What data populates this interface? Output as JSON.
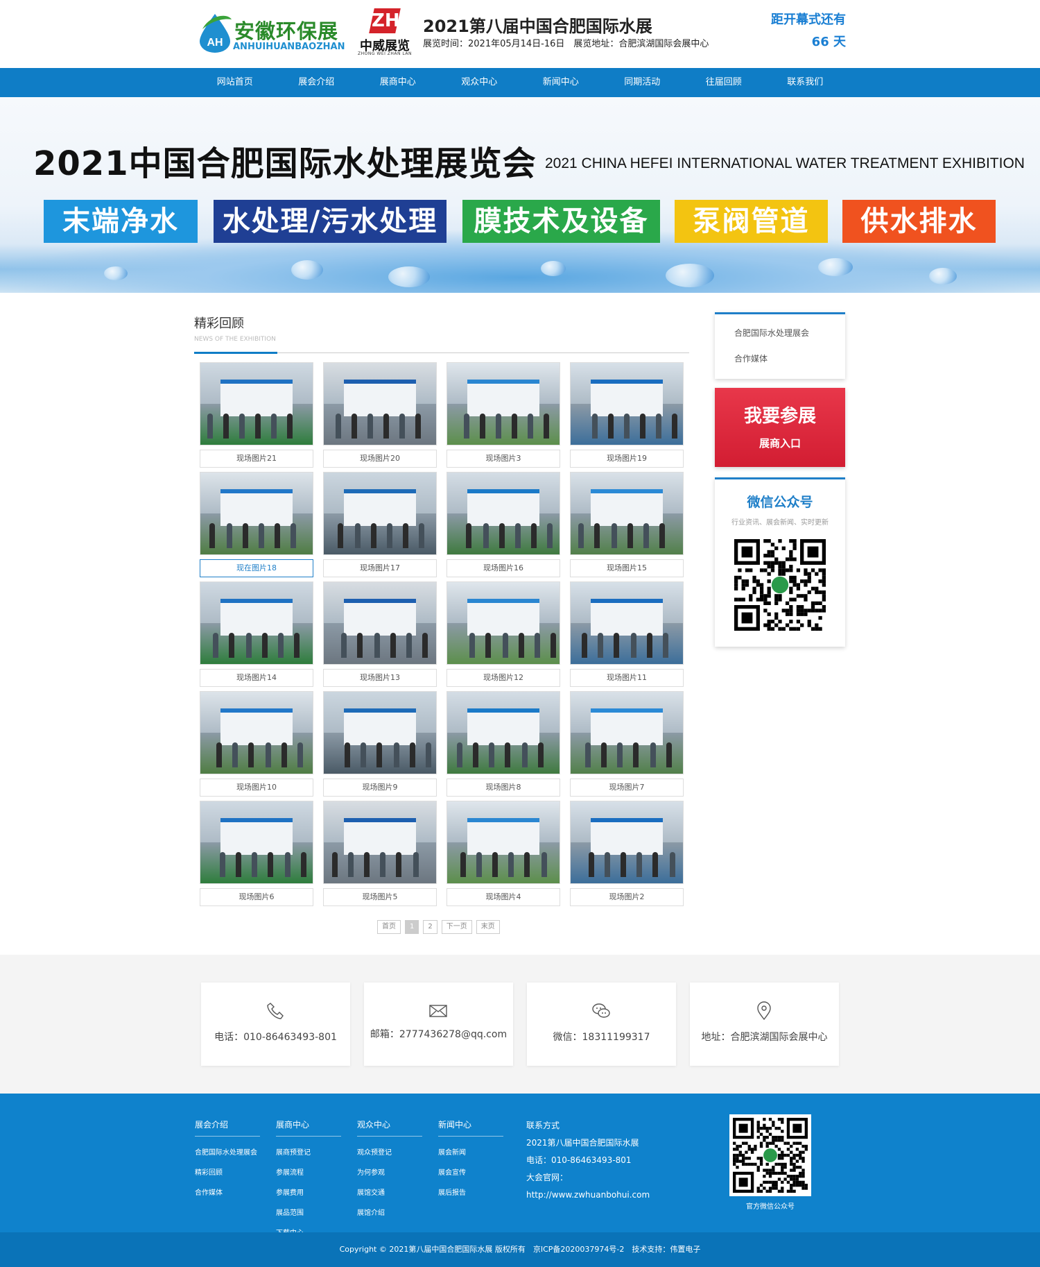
{
  "header": {
    "logo_cn": "安徽环保展",
    "logo_en": "ANHUIHUANBAOZHAN",
    "logo_mark": "AH",
    "org_logo_glyph": "ZH",
    "org_cn": "中威展览",
    "org_en": "ZHONG WEI ZHAN LAN",
    "title": "2021第八届中国合肥国际水展",
    "info": "展览时间：2021年05月14日-16日　展览地址：合肥滨湖国际会展中心",
    "countdown_label": "距开幕式还有",
    "countdown_value": "66 天"
  },
  "nav": [
    "网站首页",
    "展会介绍",
    "展商中心",
    "观众中心",
    "新闻中心",
    "同期活动",
    "往届回顾",
    "联系我们"
  ],
  "banner": {
    "title": "2021中国合肥国际水处理展览会",
    "subtitle": "2021 CHINA HEFEI INTERNATIONAL WATER TREATMENT EXHIBITION",
    "tags": [
      {
        "label": "末端净水",
        "color": "#1e96dd"
      },
      {
        "label": "水处理/污水处理",
        "color": "#1f3f94"
      },
      {
        "label": "膜技术及设备",
        "color": "#2aa84a"
      },
      {
        "label": "泵阀管道",
        "color": "#f3c411"
      },
      {
        "label": "供水排水",
        "color": "#f0521f"
      }
    ]
  },
  "section": {
    "title": "精彩回顾",
    "subtitle": "NEWS OF THE EXHIBITION"
  },
  "gallery": [
    "现场图片21",
    "现场图片20",
    "现场图片3",
    "现场图片19",
    "现在图片18",
    "现场图片17",
    "现场图片16",
    "现场图片15",
    "现场图片14",
    "现场图片13",
    "现场图片12",
    "现场图片11",
    "现场图片10",
    "现场图片9",
    "现场图片8",
    "现场图片7",
    "现场图片6",
    "现场图片5",
    "现场图片4",
    "现场图片2"
  ],
  "pager": [
    "首页",
    "1",
    "2",
    "下一页",
    "末页"
  ],
  "sidebar": {
    "links": [
      "合肥国际水处理展会",
      "合作媒体"
    ],
    "cta_title": "我要参展",
    "cta_sub": "展商入口",
    "wechat_title": "微信公众号",
    "wechat_sub": "行业资讯、展会新闻、实时更新"
  },
  "contacts": [
    {
      "icon": "phone-icon",
      "text": "电话：010-86463493-801"
    },
    {
      "icon": "mail-icon",
      "text": "邮箱：2777436278@qq.com"
    },
    {
      "icon": "wechat-icon",
      "text": "微信：18311199317"
    },
    {
      "icon": "location-icon",
      "text": "地址：合肥滨湖国际会展中心"
    }
  ],
  "footer": {
    "columns": [
      {
        "head": "展会介绍",
        "items": [
          "合肥国际水处理展会",
          "精彩回顾",
          "合作媒体"
        ]
      },
      {
        "head": "展商中心",
        "items": [
          "展商预登记",
          "参展流程",
          "参展费用",
          "展品范围",
          "下载中心"
        ]
      },
      {
        "head": "观众中心",
        "items": [
          "观众预登记",
          "为何参观",
          "展馆交通",
          "展馆介绍"
        ]
      },
      {
        "head": "新闻中心",
        "items": [
          "展会新闻",
          "展会宣传",
          "展后报告"
        ]
      }
    ],
    "contact_lines": [
      "联系方式",
      "2021第八届中国合肥国际水展",
      "电话：010-86463493-801",
      "大会官网：",
      "http://www.zwhuanbohui.com"
    ],
    "qr_label": "官方微信公众号",
    "copyright": "Copyright © 2021第八届中国合肥国际水展 版权所有　京ICP备2020037974号-2　技术支持：伟置电子"
  }
}
